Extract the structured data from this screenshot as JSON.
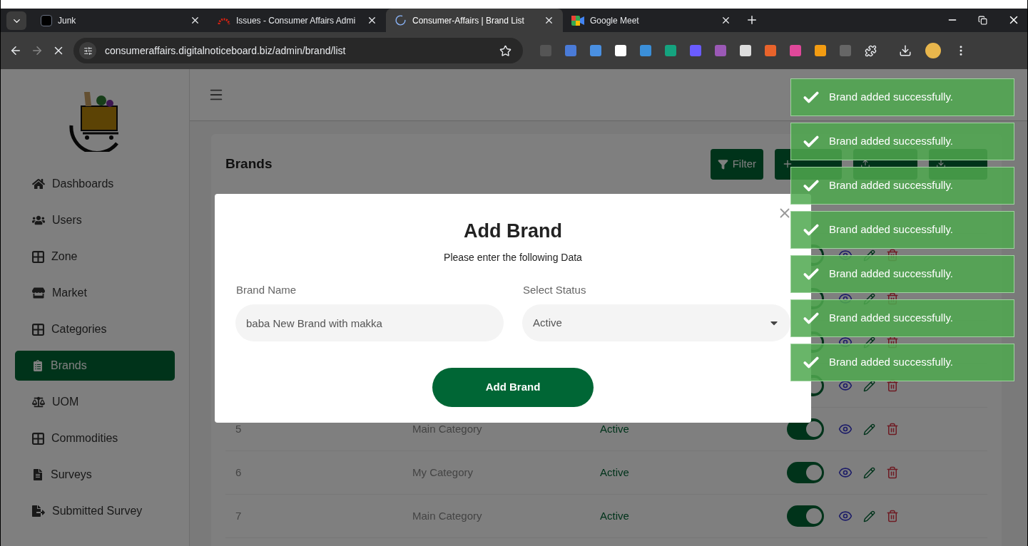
{
  "browser": {
    "tabs": [
      {
        "title": "Junk",
        "selected": false
      },
      {
        "title": "Issues - Consumer Affairs Admi",
        "selected": false
      },
      {
        "title": "Consumer-Affairs | Brand List",
        "selected": true
      },
      {
        "title": "Google Meet",
        "selected": false
      }
    ],
    "url": "consumeraffairs.digitalnoticeboard.biz/admin/brand/list"
  },
  "sidebar": {
    "items": [
      {
        "label": "Dashboards",
        "selected": false
      },
      {
        "label": "Users",
        "selected": false
      },
      {
        "label": "Zone",
        "selected": false
      },
      {
        "label": "Market",
        "selected": false
      },
      {
        "label": "Categories",
        "selected": false
      },
      {
        "label": "Brands",
        "selected": true
      },
      {
        "label": "UOM",
        "selected": false
      },
      {
        "label": "Commodities",
        "selected": false
      },
      {
        "label": "Surveys",
        "selected": false
      },
      {
        "label": "Submitted Survey",
        "selected": false
      }
    ]
  },
  "page": {
    "title": "Brands",
    "filter_button": "Filter"
  },
  "table": {
    "rows": [
      {
        "on": true
      },
      {
        "on": true
      },
      {
        "on": true
      },
      {
        "on": true
      },
      {
        "id": "5",
        "category": "Main Category",
        "status": "Active",
        "on": true
      },
      {
        "id": "6",
        "category": "My Category",
        "status": "Active",
        "on": true
      },
      {
        "id": "7",
        "category": "Main Category",
        "status": "Active",
        "on": true
      }
    ]
  },
  "modal": {
    "title": "Add Brand",
    "subtitle": "Please enter the following Data",
    "fields": [
      {
        "label": "Brand Name",
        "value": "baba New Brand with makka",
        "kind": "text"
      },
      {
        "label": "Select Status",
        "value": "Active",
        "kind": "select"
      }
    ],
    "submit": "Add Brand"
  },
  "toasts": [
    {
      "message": "Brand added successfully."
    },
    {
      "message": "Brand added successfully."
    },
    {
      "message": "Brand added successfully."
    },
    {
      "message": "Brand added successfully."
    },
    {
      "message": "Brand added successfully."
    },
    {
      "message": "Brand added successfully."
    },
    {
      "message": "Brand added successfully."
    }
  ]
}
